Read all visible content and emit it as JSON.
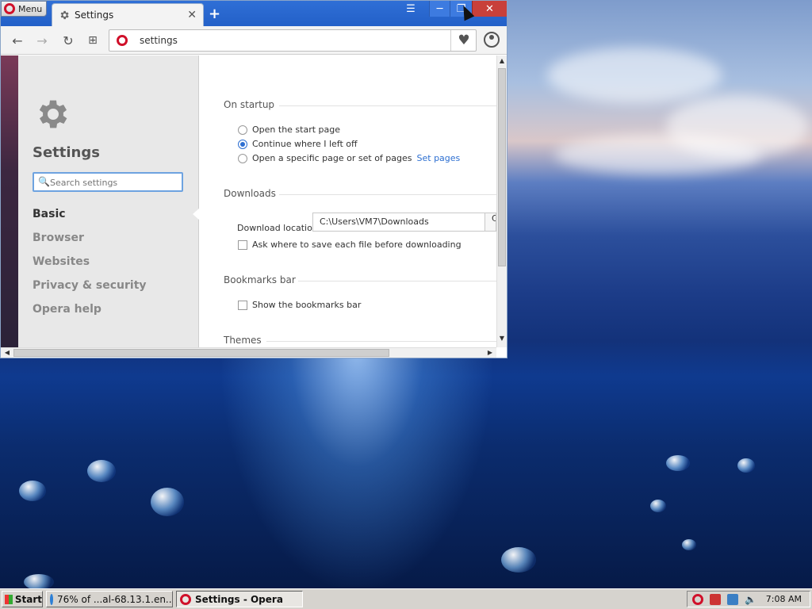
{
  "browser": {
    "menu_label": "Menu",
    "tab_title": "Settings",
    "new_tab": "+",
    "address": "settings"
  },
  "sidebar": {
    "title": "Settings",
    "search_placeholder": "Search settings",
    "items": [
      {
        "label": "Basic",
        "active": true
      },
      {
        "label": "Browser"
      },
      {
        "label": "Websites"
      },
      {
        "label": "Privacy & security"
      },
      {
        "label": "Opera help"
      }
    ]
  },
  "sections": {
    "startup": {
      "title": "On startup",
      "options": [
        "Open the start page",
        "Continue where I left off",
        "Open a specific page or set of pages"
      ],
      "selected_index": 1,
      "link": "Set pages"
    },
    "downloads": {
      "title": "Downloads",
      "location_label": "Download location:",
      "location_value": "C:\\Users\\VM7\\Downloads",
      "change_button": "C",
      "ask_label": "Ask where to save each file before downloading"
    },
    "bookmarks": {
      "title": "Bookmarks bar",
      "show_label": "Show the bookmarks bar"
    },
    "themes": {
      "title": "Themes"
    }
  },
  "taskbar": {
    "start": "Start",
    "tasks": [
      "76% of ...al-68.13.1.en...",
      "Settings - Opera"
    ],
    "clock": "7:08 AM"
  },
  "colors": {
    "titlebar": "#2360c8",
    "accent": "#2d6fd1",
    "opera_red": "#d0102a",
    "close": "#c8403a"
  }
}
